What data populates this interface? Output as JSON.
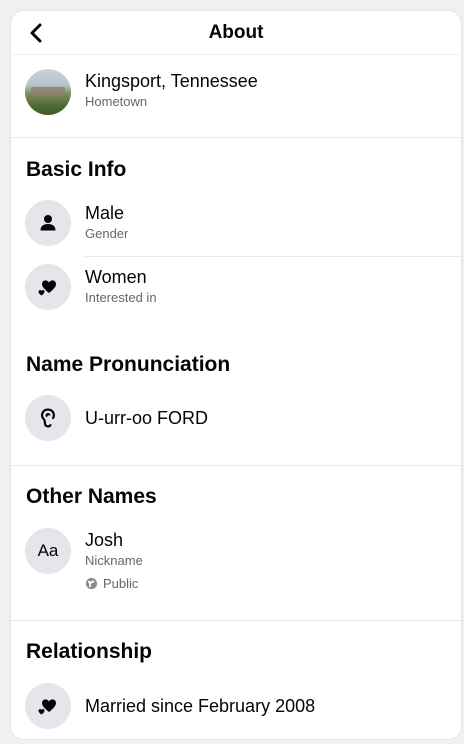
{
  "header": {
    "title": "About"
  },
  "hometown": {
    "primary": "Kingsport, Tennessee",
    "secondary": "Hometown"
  },
  "basic_info": {
    "title": "Basic Info",
    "items": [
      {
        "primary": "Male",
        "secondary": "Gender",
        "icon": "person-icon"
      },
      {
        "primary": "Women",
        "secondary": "Interested in",
        "icon": "hearts-icon"
      }
    ]
  },
  "name_pronunciation": {
    "title": "Name Pronunciation",
    "value": "U-urr-oo FORD",
    "icon": "ear-icon"
  },
  "other_names": {
    "title": "Other Names",
    "name": "Josh",
    "type": "Nickname",
    "privacy": "Public",
    "icon": "text-aa-icon"
  },
  "relationship": {
    "title": "Relationship",
    "value": "Married since February 2008",
    "icon": "hearts-icon"
  }
}
